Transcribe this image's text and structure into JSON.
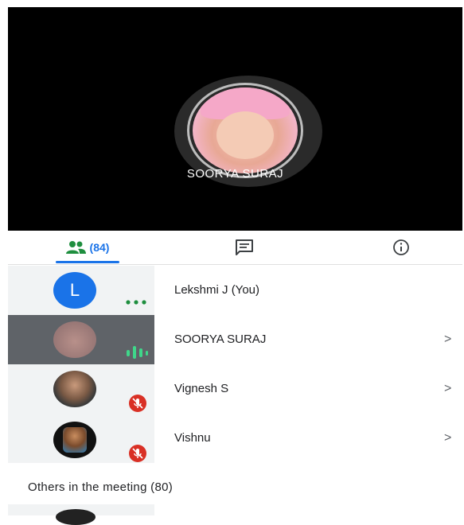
{
  "speaker": {
    "name": "SOORYA SURAJ"
  },
  "tabs": {
    "people_count": "(84)"
  },
  "participants": [
    {
      "initial": "L",
      "name": "Lekshmi J (You)",
      "chevron": ""
    },
    {
      "name": "SOORYA SURAJ",
      "chevron": ">"
    },
    {
      "name": "Vignesh S",
      "chevron": ">"
    },
    {
      "name": "Vishnu",
      "chevron": ">"
    }
  ],
  "others": {
    "label": "Others in the meeting (80)"
  },
  "colors": {
    "accent": "#1a73e8",
    "teal": "#1e8e3e",
    "mute_red": "#d93025"
  },
  "icons": [
    "people-icon",
    "chat-icon",
    "info-icon",
    "more-icon",
    "audio-level-icon",
    "mic-off-icon",
    "chevron-right-icon"
  ]
}
